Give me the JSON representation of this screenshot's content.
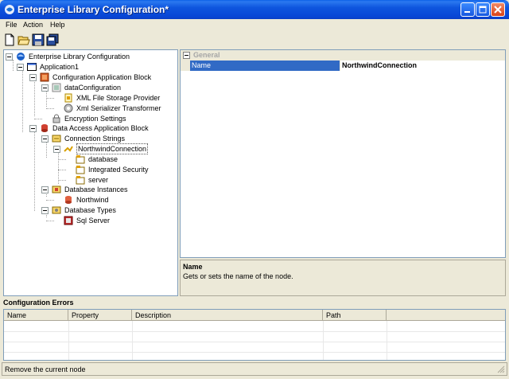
{
  "window": {
    "title": "Enterprise Library Configuration*",
    "icons": [
      "app-icon",
      "minimize-icon",
      "maximize-icon",
      "close-icon"
    ]
  },
  "menu": {
    "file": "File",
    "action": "Action",
    "help": "Help"
  },
  "toolbar": {
    "icons": [
      "new-icon",
      "open-icon",
      "save-icon",
      "save-all-icon"
    ]
  },
  "tree": {
    "root": "Enterprise Library Configuration",
    "application": "Application1",
    "config_block": "Configuration Application Block",
    "data_configuration": "dataConfiguration",
    "xml_storage": "XML File Storage Provider",
    "xml_serializer": "Xml Serializer Transformer",
    "encryption": "Encryption Settings",
    "data_access_block": "Data Access Application Block",
    "connection_strings": "Connection Strings",
    "northwind_connection": "NorthwindConnection",
    "param_database": "database",
    "param_security": "Integrated Security",
    "param_server": "server",
    "database_instances": "Database Instances",
    "northwind": "Northwind",
    "database_types": "Database Types",
    "sql_server": "Sql Server",
    "selected": "NorthwindConnection"
  },
  "properties": {
    "category": "General",
    "rows": [
      {
        "name": "Name",
        "value": "NorthwindConnection"
      }
    ]
  },
  "description": {
    "title": "Name",
    "text": "Gets or sets the name of the node."
  },
  "errors": {
    "title": "Configuration Errors",
    "columns": [
      "Name",
      "Property",
      "Description",
      "Path"
    ]
  },
  "status": {
    "text": "Remove the current node"
  },
  "colors": {
    "titlebar": "#0846d6",
    "selection": "#316ac5",
    "chrome": "#ece9d8"
  }
}
